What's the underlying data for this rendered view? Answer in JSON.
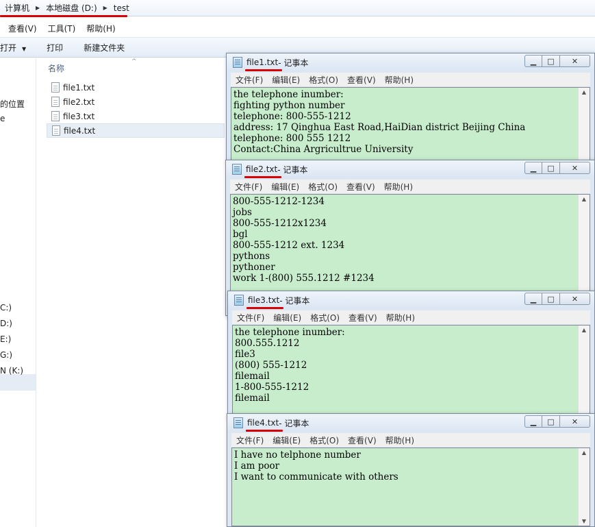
{
  "explorer": {
    "breadcrumb": [
      "计算机",
      "本地磁盘 (D:)",
      "test"
    ],
    "menu": [
      "查看(V)",
      "工具(T)",
      "帮助(H)"
    ],
    "toolbar": {
      "open": "打开",
      "print": "打印",
      "new_folder": "新建文件夹"
    },
    "nav_items": [
      "的位置",
      "e",
      "C:)",
      "D:)",
      "E:)",
      "G:)",
      "N (K:)"
    ],
    "column_header": "名称",
    "files": [
      "file1.txt",
      "file2.txt",
      "file3.txt",
      "file4.txt"
    ],
    "selected_file": "file4.txt"
  },
  "notepad_app": "记事本",
  "notepad_menu": [
    "文件(F)",
    "编辑(E)",
    "格式(O)",
    "查看(V)",
    "帮助(H)"
  ],
  "notepads": [
    {
      "filename": "file1.txt",
      "suffix": " - 记事本",
      "text": "the telephone inumber:\nfighting python number\ntelephone: 800-555-1212\naddress: 17 Qinghua East Road,HaiDian district Beijing China\ntelephone: 800 555 1212\nContact:China Argricultrue University"
    },
    {
      "filename": "file2.txt",
      "suffix": " - 记事本",
      "text": "800-555-1212-1234\njobs\n800-555-1212x1234\nbgl\n800-555-1212 ext. 1234\npythons\npythoner\nwork 1-(800) 555.1212 #1234"
    },
    {
      "filename": "file3.txt",
      "suffix": " - 记事本",
      "text": "the telephone inumber:\n800.555.1212\nfile3\n(800) 555-1212\nfilemail\n1-800-555-1212\nfilemail"
    },
    {
      "filename": "file4.txt",
      "suffix": " - 记事本",
      "text": "I have no telphone number\nI am poor\nI want to communicate with others"
    }
  ],
  "window_controls": {
    "minimize": "▁",
    "maximize": "□",
    "close": "✕"
  },
  "colors": {
    "editor_bg": "#c7edcc",
    "underline": "#d80000"
  }
}
